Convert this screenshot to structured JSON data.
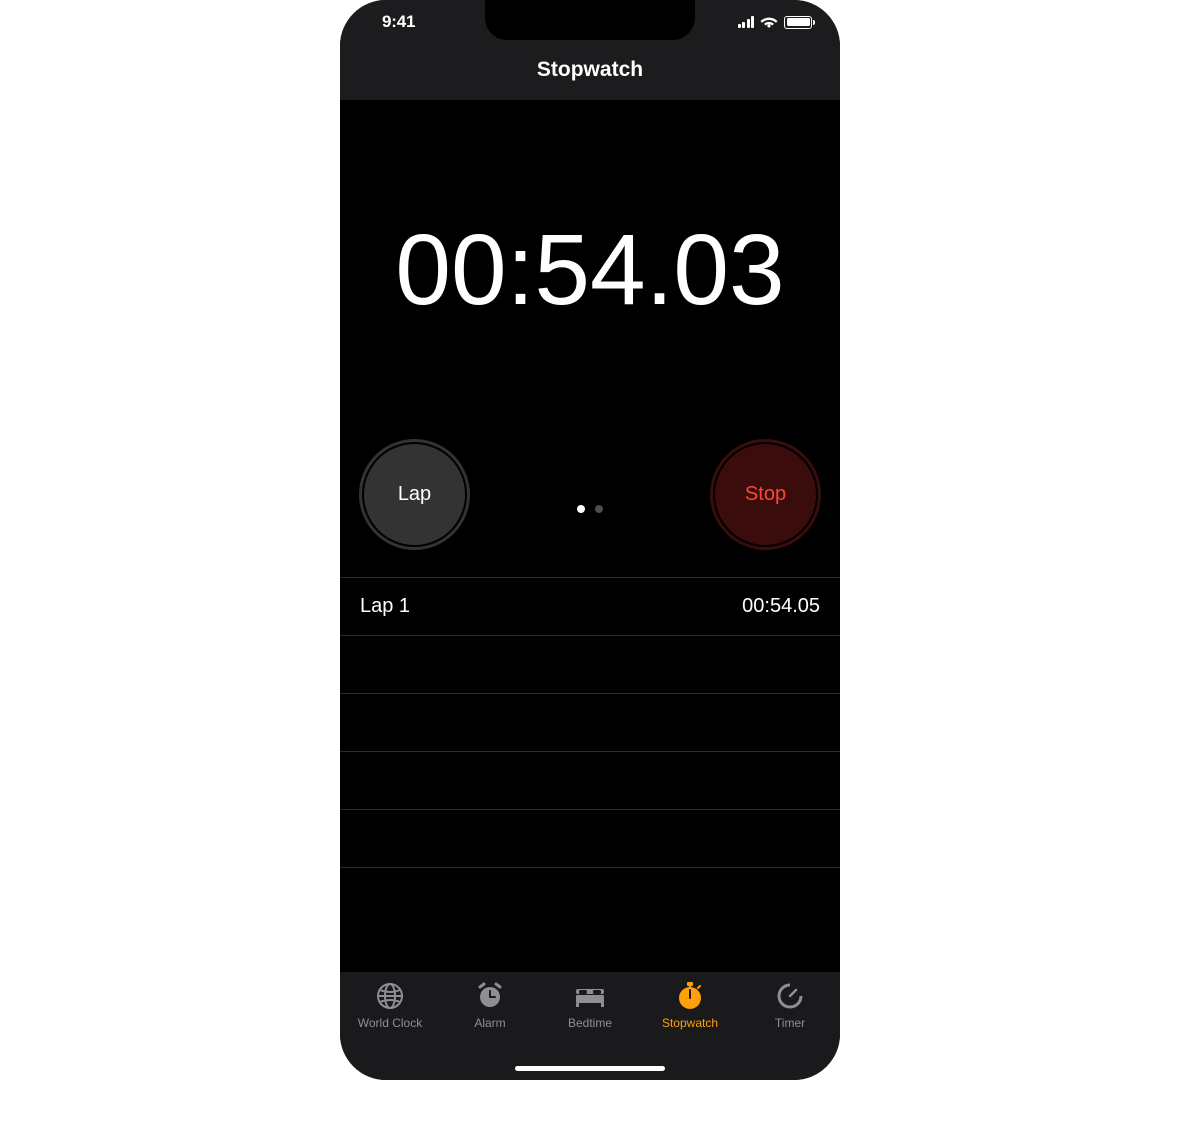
{
  "status": {
    "time": "9:41"
  },
  "header": {
    "title": "Stopwatch"
  },
  "timer": {
    "display": "00:54.03"
  },
  "controls": {
    "lap_label": "Lap",
    "stop_label": "Stop",
    "stop_color": "#ff453a"
  },
  "page_indicator": {
    "count": 2,
    "active": 0
  },
  "laps": [
    {
      "label": "Lap 1",
      "time": "00:54.05"
    }
  ],
  "empty_lap_rows": 4,
  "tabbar": {
    "items": [
      {
        "label": "World Clock",
        "icon": "globe-icon",
        "active": false
      },
      {
        "label": "Alarm",
        "icon": "alarm-clock-icon",
        "active": false
      },
      {
        "label": "Bedtime",
        "icon": "bed-icon",
        "active": false
      },
      {
        "label": "Stopwatch",
        "icon": "stopwatch-icon",
        "active": true
      },
      {
        "label": "Timer",
        "icon": "timer-icon",
        "active": false
      }
    ]
  },
  "colors": {
    "accent": "#ff9f0a"
  }
}
